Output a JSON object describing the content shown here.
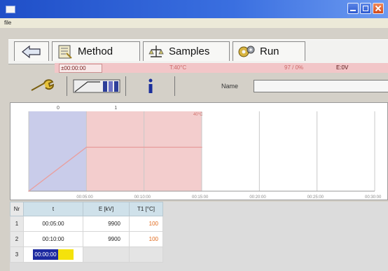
{
  "window": {
    "menu_label": "file"
  },
  "tabs": [
    {
      "label": "Method"
    },
    {
      "label": "Samples"
    },
    {
      "label": "Run"
    }
  ],
  "status": {
    "time": "±00:00:00",
    "temp": "T:40°C",
    "percent": "97 / 0%",
    "energy": "E:0V"
  },
  "toolbar2": {
    "name_label": "Name",
    "name_value": ""
  },
  "chart": {
    "top_markers": [
      "0",
      "1"
    ],
    "x_tick_labels": [
      "00:05:00",
      "00:10:00",
      "00:15:00",
      "00:20:00",
      "00:25:00",
      "00:30:00"
    ],
    "temp_annotation": "40°C"
  },
  "chart_data": {
    "type": "area",
    "x": [
      0,
      5,
      10,
      15,
      20,
      25,
      30
    ],
    "xlabel": "",
    "ylabel": "",
    "regions": [
      {
        "start": 0,
        "end": 5,
        "color": "#c9ccea"
      },
      {
        "start": 5,
        "end": 15,
        "color": "#f3cdcd"
      }
    ],
    "series": [
      {
        "values": [
          0,
          0.55,
          0.55,
          0.55,
          null,
          null,
          null
        ],
        "color": "#e8a0a0"
      }
    ]
  },
  "table": {
    "headers": [
      "Nr",
      "t",
      "E [kV]",
      "T1 [°C]"
    ],
    "rows": [
      {
        "nr": "1",
        "t": "00:05:00",
        "e": "9900",
        "t1": "100"
      },
      {
        "nr": "2",
        "t": "00:10:00",
        "e": "9900",
        "t1": "100"
      },
      {
        "nr": "3",
        "t": "00:00:00",
        "e": "",
        "t1": ""
      }
    ]
  }
}
